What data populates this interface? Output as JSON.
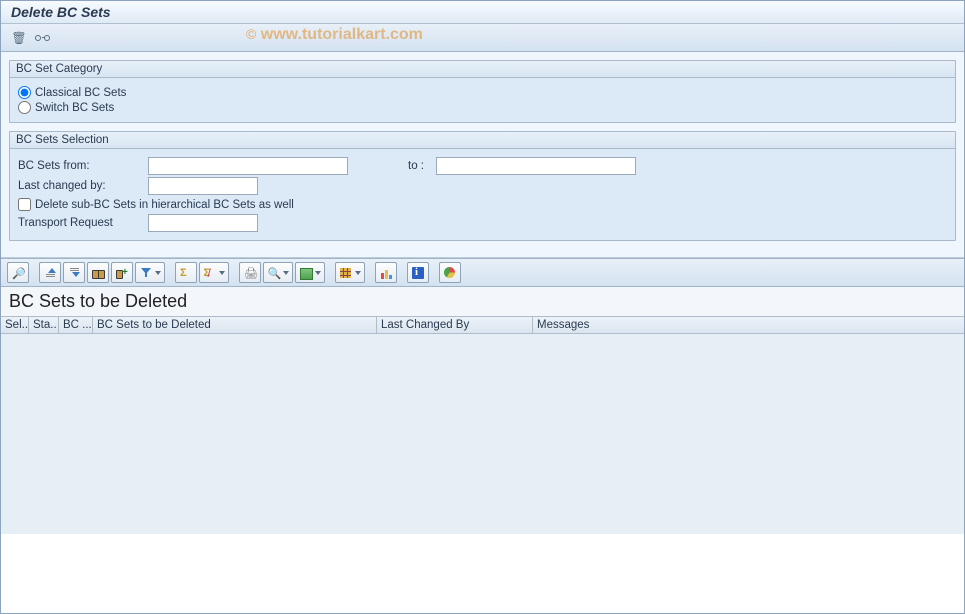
{
  "title": "Delete BC Sets",
  "watermark": "© www.tutorialkart.com",
  "group_category": {
    "title": "BC Set Category",
    "opt_classical": "Classical BC Sets",
    "opt_switch": "Switch BC Sets",
    "selected": "classical"
  },
  "group_selection": {
    "title": "BC Sets Selection",
    "from_label": "BC Sets from:",
    "to_label": "to :",
    "from_value": "",
    "to_value": "",
    "last_changed_label": "Last changed by:",
    "last_changed_value": "",
    "delete_sub_label": "Delete sub-BC Sets in hierarchical BC Sets as well",
    "delete_sub_checked": false,
    "transport_label": "Transport Request",
    "transport_value": ""
  },
  "grid": {
    "title": "BC Sets to be Deleted",
    "columns": {
      "sel": "Sel..",
      "status": "Sta..",
      "bc": "BC ...",
      "desc": "BC Sets to be Deleted",
      "changed": "Last Changed By",
      "messages": "Messages"
    }
  },
  "column_widths": {
    "sel": 28,
    "status": 30,
    "bc": 34,
    "desc": 284,
    "changed": 156,
    "messages": 150
  }
}
